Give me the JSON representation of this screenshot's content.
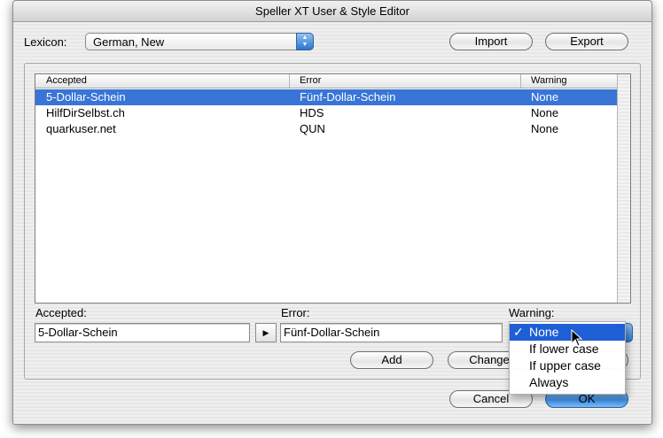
{
  "window": {
    "title": "Speller XT User & Style Editor"
  },
  "lexicon": {
    "label": "Lexicon:",
    "value": "German, New"
  },
  "buttons": {
    "import": "Import",
    "export": "Export",
    "add": "Add",
    "change": "Change",
    "cancel": "Cancel",
    "ok": "OK"
  },
  "table": {
    "columns": [
      "Accepted",
      "Error",
      "Warning"
    ],
    "rows": [
      {
        "accepted": "5-Dollar-Schein",
        "error": "Fünf-Dollar-Schein",
        "warning": "None",
        "selected": true
      },
      {
        "accepted": "HilfDirSelbst.ch",
        "error": "HDS",
        "warning": "None",
        "selected": false
      },
      {
        "accepted": "quarkuser.net",
        "error": "QUN",
        "warning": "None",
        "selected": false
      }
    ]
  },
  "editor": {
    "accepted_label": "Accepted:",
    "accepted_value": "5-Dollar-Schein",
    "error_label": "Error:",
    "error_value": "Fünf-Dollar-Schein",
    "warning_label": "Warning:"
  },
  "warning_menu": {
    "items": [
      {
        "label": "None",
        "checked": true,
        "highlighted": true
      },
      {
        "label": "If lower case",
        "checked": false,
        "highlighted": false
      },
      {
        "label": "If upper case",
        "checked": false,
        "highlighted": false
      },
      {
        "label": "Always",
        "checked": false,
        "highlighted": false
      }
    ],
    "check_glyph": "✓"
  },
  "icons": {
    "popup_arrows": "updown-arrows-icon",
    "copy_arrow": "right-triangle-icon",
    "cursor": "mouse-pointer-icon"
  },
  "colors": {
    "selection": "#3875d7",
    "menu_highlight": "#1e5fd6",
    "default_button": "#3b8ee6"
  }
}
